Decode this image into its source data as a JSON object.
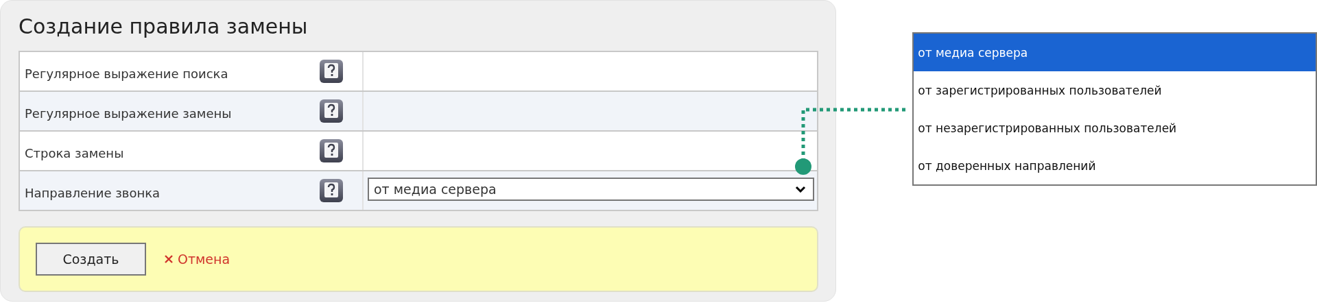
{
  "form": {
    "title": "Создание правила замены",
    "rows": [
      {
        "label": "Регулярное выражение поиска",
        "kind": "text"
      },
      {
        "label": "Регулярное выражение замены",
        "kind": "text"
      },
      {
        "label": "Строка замены",
        "kind": "text"
      },
      {
        "label": "Направление звонка",
        "kind": "select",
        "value": "от медиа сервера"
      }
    ],
    "create_button": "Создать",
    "cancel_link": "Отмена"
  },
  "dropdown": {
    "options": [
      {
        "label": "от медиа сервера",
        "selected": true
      },
      {
        "label": "от зарегистрированных пользователей",
        "selected": false
      },
      {
        "label": "от незарегистрированных пользователей",
        "selected": false
      },
      {
        "label": "от доверенных направлений",
        "selected": false
      }
    ]
  }
}
